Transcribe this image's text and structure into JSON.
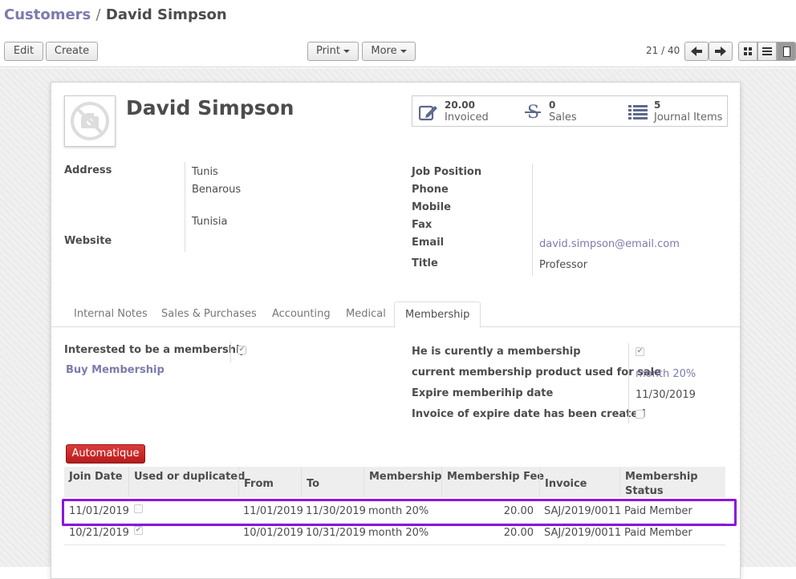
{
  "breadcrumb": {
    "parent": "Customers",
    "separator": "/",
    "current": "David Simpson"
  },
  "toolbar": {
    "edit": "Edit",
    "create": "Create",
    "print": "Print",
    "more": "More"
  },
  "pager": {
    "text": "21 / 40"
  },
  "partner": {
    "name": "David Simpson",
    "stats": [
      {
        "number": "20.00",
        "label": "Invoiced",
        "icon": "edit-icon"
      },
      {
        "number": "0",
        "label": "Sales",
        "icon": "strikethrough-s-icon"
      },
      {
        "number": "5",
        "label": "Journal Items",
        "icon": "list-icon"
      }
    ],
    "address_label": "Address",
    "address_line1": "Tunis",
    "address_line2": "Benarous",
    "address_country": "Tunisia",
    "website_label": "Website",
    "job_position_label": "Job Position",
    "phone_label": "Phone",
    "mobile_label": "Mobile",
    "fax_label": "Fax",
    "email_label": "Email",
    "email": "david.simpson@email.com",
    "title_label": "Title",
    "title": "Professor"
  },
  "tabs": [
    "Internal Notes",
    "Sales & Purchases",
    "Accounting",
    "Medical",
    "Membership"
  ],
  "membership": {
    "interested_label": "Interested to be a membership",
    "buy_link": "Buy Membership",
    "current_label": "He is curently a membership",
    "product_label": "current membership product used for sale",
    "product_value": "month 20%",
    "expire_label": "Expire memberihip date",
    "expire_value": "11/30/2019",
    "invoice_expire_label": "Invoice of expire date has been created",
    "auto_button": "Automatique",
    "columns": [
      "Join Date",
      "Used or duplicated",
      "From",
      "To",
      "Membership",
      "Membership Fee",
      "Invoice",
      "Membership Status"
    ],
    "rows": [
      {
        "join": "11/01/2019",
        "used": false,
        "from": "11/01/2019",
        "to": "11/30/2019",
        "membership": "month 20%",
        "fee": "20.00",
        "invoice": "SAJ/2019/0011",
        "status": "Paid Member"
      },
      {
        "join": "10/21/2019",
        "used": true,
        "from": "10/01/2019",
        "to": "10/31/2019",
        "membership": "month 20%",
        "fee": "20.00",
        "invoice": "SAJ/2019/0011",
        "status": "Paid Member"
      }
    ]
  },
  "colors": {
    "accent_link": "#7c7bad",
    "primary_button": "#c62828",
    "highlight": "#8a16e0"
  }
}
